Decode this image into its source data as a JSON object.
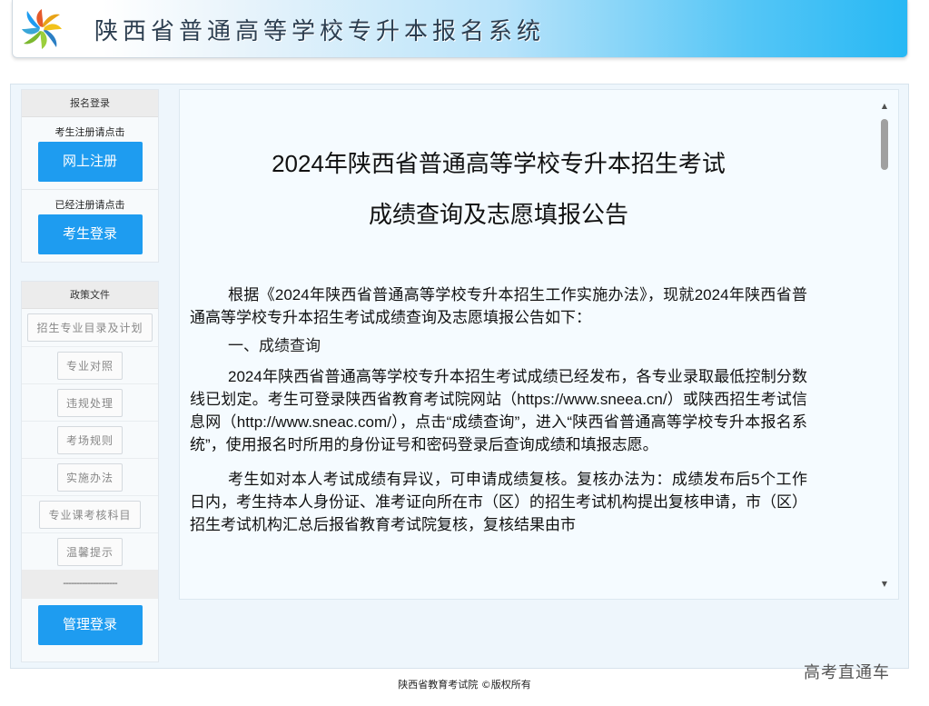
{
  "header": {
    "title": "陕西省普通高等学校专升本报名系统",
    "logo_icon": "pinwheel-logo-icon"
  },
  "sidebar": {
    "login_box": {
      "title": "报名登录",
      "register_hint": "考生注册请点击",
      "register_button": "网上注册",
      "login_hint": "已经注册请点击",
      "login_button": "考生登录"
    },
    "policy_box": {
      "title": "政策文件",
      "links": [
        "招生专业目录及计划",
        "专业对照",
        "违规处理",
        "考场规则",
        "实施办法",
        "专业课考核科目",
        "温馨提示"
      ],
      "divider": "--------------------",
      "admin_button": "管理登录"
    }
  },
  "notice": {
    "title_line1": "2024年陕西省普通高等学校专升本招生考试",
    "title_line2": "成绩查询及志愿填报公告",
    "paragraph1": "根据《2024年陕西省普通高等学校专升本招生工作实施办法》，现就2024年陕西省普通高等学校专升本招生考试成绩查询及志愿填报公告如下：",
    "section1": "一、成绩查询",
    "paragraph2": "2024年陕西省普通高等学校专升本招生考试成绩已经发布，各专业录取最低控制分数线已划定。考生可登录陕西省教育考试院网站（https://www.sneea.cn/）或陕西招生考试信息网（http://www.sneac.com/），点击“成绩查询”，进入“陕西省普通高等学校专升本报名系统”，使用报名时所用的身份证号和密码登录后查询成绩和填报志愿。",
    "paragraph3": "考生如对本人考试成绩有异议，可申请成绩复核。复核办法为：成绩发布后5个工作日内，考生持本人身份证、准考证向所在市（区）的招生考试机构提出复核申请，市（区）招生考试机构汇总后报省教育考试院复核，复核结果由市"
  },
  "footer": {
    "copyright": "陕西省教育考试院 ©版权所有"
  },
  "watermark": "高考直通车",
  "colors": {
    "accent_blue": "#1e9cf0",
    "header_gradient_end": "#27b8f4"
  }
}
